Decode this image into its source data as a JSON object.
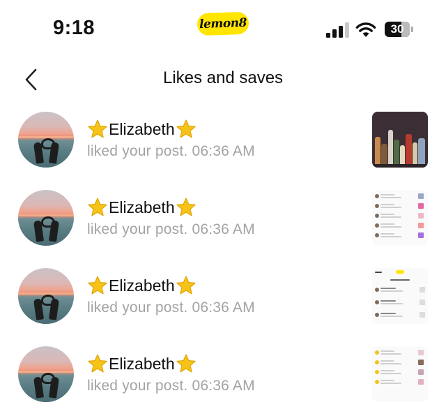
{
  "status_bar": {
    "time": "9:18",
    "app_badge": "lemon8",
    "battery": "30"
  },
  "header": {
    "title": "Likes and saves"
  },
  "notifications": [
    {
      "user": "Elizabeth",
      "action": "liked your post. 06:36 AM",
      "thumbnail": "photo-bottles"
    },
    {
      "user": "Elizabeth",
      "action": "liked your post. 06:36 AM",
      "thumbnail": "screenshot-list"
    },
    {
      "user": "Elizabeth",
      "action": "liked your post. 06:36 AM",
      "thumbnail": "screenshot-likes"
    },
    {
      "user": "Elizabeth",
      "action": "liked your post. 06:36 AM",
      "thumbnail": "screenshot-list"
    }
  ],
  "colors": {
    "badge_yellow": "#ffe500",
    "secondary_text": "#a3a3a3",
    "star_yellow": "#f7c318"
  },
  "icons": [
    "back-chevron-icon",
    "signal-icon",
    "wifi-icon",
    "battery-icon",
    "star-icon"
  ]
}
